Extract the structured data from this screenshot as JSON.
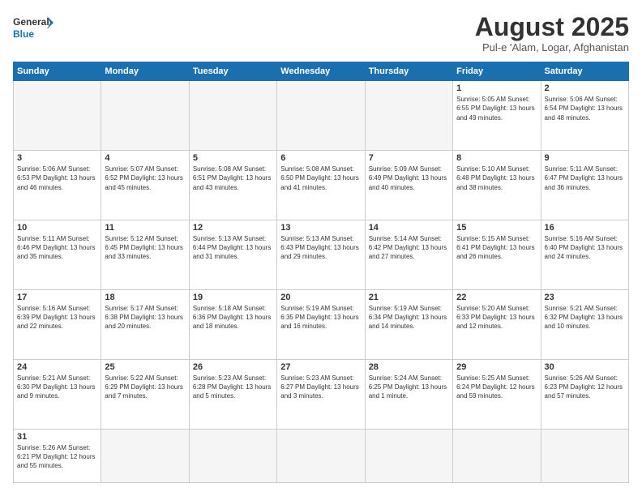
{
  "header": {
    "logo_general": "General",
    "logo_blue": "Blue",
    "month_year": "August 2025",
    "location": "Pul-e 'Alam, Logar, Afghanistan"
  },
  "days_of_week": [
    "Sunday",
    "Monday",
    "Tuesday",
    "Wednesday",
    "Thursday",
    "Friday",
    "Saturday"
  ],
  "weeks": [
    [
      {
        "day": "",
        "info": ""
      },
      {
        "day": "",
        "info": ""
      },
      {
        "day": "",
        "info": ""
      },
      {
        "day": "",
        "info": ""
      },
      {
        "day": "",
        "info": ""
      },
      {
        "day": "1",
        "info": "Sunrise: 5:05 AM\nSunset: 6:55 PM\nDaylight: 13 hours\nand 49 minutes."
      },
      {
        "day": "2",
        "info": "Sunrise: 5:06 AM\nSunset: 6:54 PM\nDaylight: 13 hours\nand 48 minutes."
      }
    ],
    [
      {
        "day": "3",
        "info": "Sunrise: 5:06 AM\nSunset: 6:53 PM\nDaylight: 13 hours\nand 46 minutes."
      },
      {
        "day": "4",
        "info": "Sunrise: 5:07 AM\nSunset: 6:52 PM\nDaylight: 13 hours\nand 45 minutes."
      },
      {
        "day": "5",
        "info": "Sunrise: 5:08 AM\nSunset: 6:51 PM\nDaylight: 13 hours\nand 43 minutes."
      },
      {
        "day": "6",
        "info": "Sunrise: 5:08 AM\nSunset: 6:50 PM\nDaylight: 13 hours\nand 41 minutes."
      },
      {
        "day": "7",
        "info": "Sunrise: 5:09 AM\nSunset: 6:49 PM\nDaylight: 13 hours\nand 40 minutes."
      },
      {
        "day": "8",
        "info": "Sunrise: 5:10 AM\nSunset: 6:48 PM\nDaylight: 13 hours\nand 38 minutes."
      },
      {
        "day": "9",
        "info": "Sunrise: 5:11 AM\nSunset: 6:47 PM\nDaylight: 13 hours\nand 36 minutes."
      }
    ],
    [
      {
        "day": "10",
        "info": "Sunrise: 5:11 AM\nSunset: 6:46 PM\nDaylight: 13 hours\nand 35 minutes."
      },
      {
        "day": "11",
        "info": "Sunrise: 5:12 AM\nSunset: 6:45 PM\nDaylight: 13 hours\nand 33 minutes."
      },
      {
        "day": "12",
        "info": "Sunrise: 5:13 AM\nSunset: 6:44 PM\nDaylight: 13 hours\nand 31 minutes."
      },
      {
        "day": "13",
        "info": "Sunrise: 5:13 AM\nSunset: 6:43 PM\nDaylight: 13 hours\nand 29 minutes."
      },
      {
        "day": "14",
        "info": "Sunrise: 5:14 AM\nSunset: 6:42 PM\nDaylight: 13 hours\nand 27 minutes."
      },
      {
        "day": "15",
        "info": "Sunrise: 5:15 AM\nSunset: 6:41 PM\nDaylight: 13 hours\nand 26 minutes."
      },
      {
        "day": "16",
        "info": "Sunrise: 5:16 AM\nSunset: 6:40 PM\nDaylight: 13 hours\nand 24 minutes."
      }
    ],
    [
      {
        "day": "17",
        "info": "Sunrise: 5:16 AM\nSunset: 6:39 PM\nDaylight: 13 hours\nand 22 minutes."
      },
      {
        "day": "18",
        "info": "Sunrise: 5:17 AM\nSunset: 6:38 PM\nDaylight: 13 hours\nand 20 minutes."
      },
      {
        "day": "19",
        "info": "Sunrise: 5:18 AM\nSunset: 6:36 PM\nDaylight: 13 hours\nand 18 minutes."
      },
      {
        "day": "20",
        "info": "Sunrise: 5:19 AM\nSunset: 6:35 PM\nDaylight: 13 hours\nand 16 minutes."
      },
      {
        "day": "21",
        "info": "Sunrise: 5:19 AM\nSunset: 6:34 PM\nDaylight: 13 hours\nand 14 minutes."
      },
      {
        "day": "22",
        "info": "Sunrise: 5:20 AM\nSunset: 6:33 PM\nDaylight: 13 hours\nand 12 minutes."
      },
      {
        "day": "23",
        "info": "Sunrise: 5:21 AM\nSunset: 6:32 PM\nDaylight: 13 hours\nand 10 minutes."
      }
    ],
    [
      {
        "day": "24",
        "info": "Sunrise: 5:21 AM\nSunset: 6:30 PM\nDaylight: 13 hours\nand 9 minutes."
      },
      {
        "day": "25",
        "info": "Sunrise: 5:22 AM\nSunset: 6:29 PM\nDaylight: 13 hours\nand 7 minutes."
      },
      {
        "day": "26",
        "info": "Sunrise: 5:23 AM\nSunset: 6:28 PM\nDaylight: 13 hours\nand 5 minutes."
      },
      {
        "day": "27",
        "info": "Sunrise: 5:23 AM\nSunset: 6:27 PM\nDaylight: 13 hours\nand 3 minutes."
      },
      {
        "day": "28",
        "info": "Sunrise: 5:24 AM\nSunset: 6:25 PM\nDaylight: 13 hours\nand 1 minute."
      },
      {
        "day": "29",
        "info": "Sunrise: 5:25 AM\nSunset: 6:24 PM\nDaylight: 12 hours\nand 59 minutes."
      },
      {
        "day": "30",
        "info": "Sunrise: 5:26 AM\nSunset: 6:23 PM\nDaylight: 12 hours\nand 57 minutes."
      }
    ],
    [
      {
        "day": "31",
        "info": "Sunrise: 5:26 AM\nSunset: 6:21 PM\nDaylight: 12 hours\nand 55 minutes."
      },
      {
        "day": "",
        "info": ""
      },
      {
        "day": "",
        "info": ""
      },
      {
        "day": "",
        "info": ""
      },
      {
        "day": "",
        "info": ""
      },
      {
        "day": "",
        "info": ""
      },
      {
        "day": "",
        "info": ""
      }
    ]
  ]
}
